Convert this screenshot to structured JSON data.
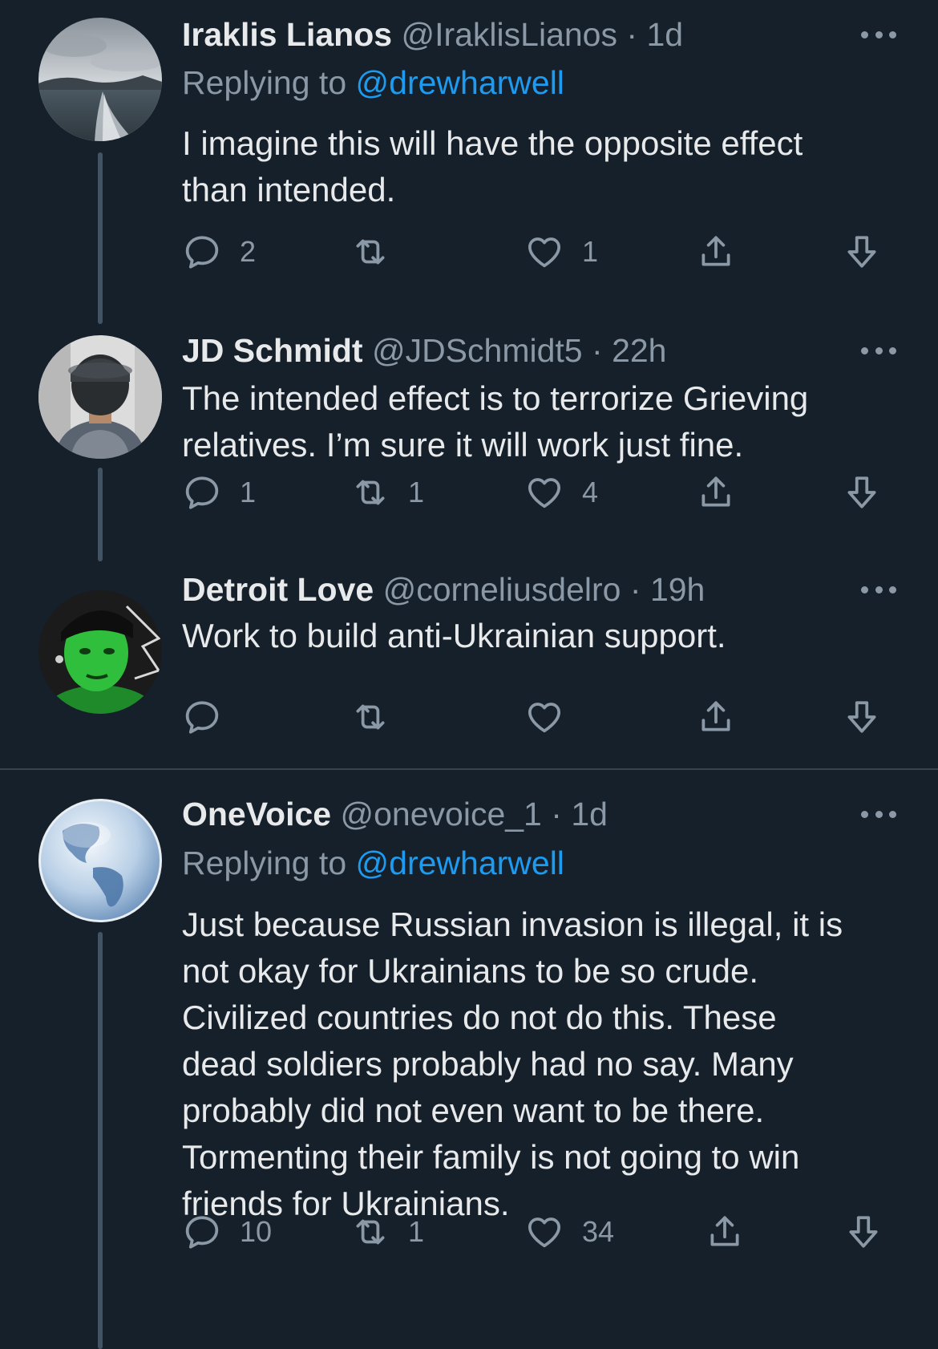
{
  "colors": {
    "background": "#15202b",
    "text": "#e7e9ea",
    "secondary": "#8b98a5",
    "link": "#1d9bf0",
    "thread_line": "#425364",
    "divider": "#38444d"
  },
  "tweets": [
    {
      "name": "Iraklis Lianos",
      "handle": "@IraklisLianos",
      "dot": "·",
      "time": "1d",
      "replying_label": "Replying to",
      "replying_to": "@drewharwell",
      "text": "I imagine this will have the opposite effect\nthan intended.",
      "avatar_icon": "seascape-avatar",
      "replies": "2",
      "retweets": "",
      "likes": "1"
    },
    {
      "name": "JD Schmidt",
      "handle": "@JDSchmidt5",
      "dot": "·",
      "time": "22h",
      "text": "The intended effect is to terrorize Grieving\nrelatives. I’m sure it will work just fine.",
      "avatar_icon": "person-back-avatar",
      "replies": "1",
      "retweets": "1",
      "likes": "4"
    },
    {
      "name": "Detroit Love",
      "handle": "@corneliusdelro",
      "dot": "·",
      "time": "19h",
      "text": "Work to build anti-Ukrainian support.",
      "avatar_icon": "green-face-avatar",
      "replies": "",
      "retweets": "",
      "likes": ""
    },
    {
      "name": "OneVoice",
      "handle": "@onevoice_1",
      "dot": "·",
      "time": "1d",
      "replying_label": "Replying to",
      "replying_to": "@drewharwell",
      "text": "Just because Russian invasion is illegal, it is\nnot okay for Ukrainians to be so crude.\nCivilized countries do not do this. These\ndead soldiers probably had no say. Many\nprobably did not even want to be there.\nTormenting their family is not going to win\nfriends for Ukrainians.",
      "avatar_icon": "globe-avatar",
      "replies": "10",
      "retweets": "1",
      "likes": "34"
    }
  ]
}
